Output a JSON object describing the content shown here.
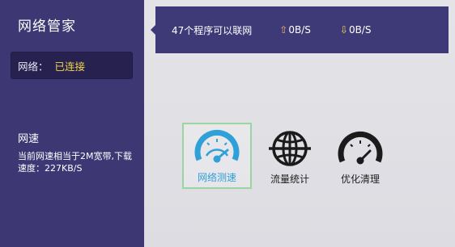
{
  "sidebar": {
    "title": "网络管家",
    "status_label": "网络：",
    "status_value": "已连接",
    "speed_title": "网速",
    "speed_desc": "当前网速相当于2M宽带,下载速度：227KB/S"
  },
  "topbar": {
    "apps_online": "47个程序可以联网",
    "upload_speed": "0B/S",
    "download_speed": "0B/S",
    "upload_icon": "arrow-up-icon",
    "download_icon": "arrow-down-icon"
  },
  "tools": [
    {
      "label": "网络测速",
      "icon": "speedometer-icon",
      "selected": true
    },
    {
      "label": "流量统计",
      "icon": "globe-icon",
      "selected": false
    },
    {
      "label": "优化清理",
      "icon": "gauge-icon",
      "selected": false
    }
  ],
  "colors": {
    "sidebar_bg": "#3d3774",
    "topbar_bg": "#3e3a78",
    "status_value": "#f2d648",
    "accent_blue": "#2fa0d8",
    "selected_border": "#9ad4a2"
  }
}
